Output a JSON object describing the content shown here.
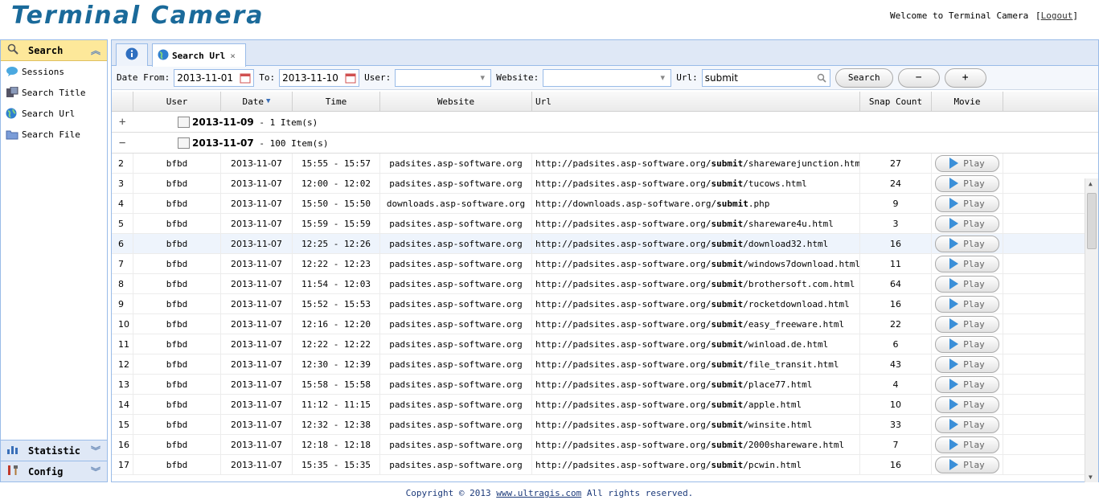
{
  "app": {
    "title": "Terminal Camera",
    "welcome": "Welcome to Terminal Camera",
    "logout": "Logout",
    "bracket_open": "[",
    "bracket_close": "]"
  },
  "sidebar": {
    "search_header": "Search",
    "items": [
      {
        "label": "Sessions",
        "icon": "sessions-icon"
      },
      {
        "label": "Search Title",
        "icon": "search-title-icon"
      },
      {
        "label": "Search Url",
        "icon": "globe-icon"
      },
      {
        "label": "Search File",
        "icon": "folder-icon"
      }
    ],
    "statistic_header": "Statistic",
    "config_header": "Config"
  },
  "tabs": {
    "info_icon": "info-icon",
    "active_label": "Search Url",
    "close": "×"
  },
  "toolbar": {
    "date_from_label": "Date From:",
    "date_from_value": "2013-11-01",
    "to_label": "To:",
    "to_value": "2013-11-10",
    "user_label": "User:",
    "user_value": "",
    "website_label": "Website:",
    "website_value": "",
    "url_label": "Url:",
    "url_value": "submit",
    "search_button": "Search",
    "collapse_button": "−",
    "expand_button": "+"
  },
  "grid": {
    "columns": [
      "",
      "User",
      "Date",
      "Time",
      "Website",
      "Url",
      "Snap Count",
      "Movie"
    ],
    "sort_indicator": "▼",
    "groups": [
      {
        "toggle": "+",
        "date": "2013-11-09",
        "summary": " - 1 Item(s)"
      },
      {
        "toggle": "−",
        "date": "2013-11-07",
        "summary": " - 100 Item(s)"
      }
    ],
    "play_label": "Play",
    "rows": [
      {
        "n": "2",
        "user": "bfbd",
        "date": "2013-11-07",
        "time": "15:55 - 15:57",
        "website": "padsites.asp-software.org",
        "url_pre": "http://padsites.asp-software.org/",
        "url_hl": "submit",
        "url_post": "/sharewarejunction.html",
        "snap": "27"
      },
      {
        "n": "3",
        "user": "bfbd",
        "date": "2013-11-07",
        "time": "12:00 - 12:02",
        "website": "padsites.asp-software.org",
        "url_pre": "http://padsites.asp-software.org/",
        "url_hl": "submit",
        "url_post": "/tucows.html",
        "snap": "24"
      },
      {
        "n": "4",
        "user": "bfbd",
        "date": "2013-11-07",
        "time": "15:50 - 15:50",
        "website": "downloads.asp-software.org",
        "url_pre": "http://downloads.asp-software.org/",
        "url_hl": "submit",
        "url_post": ".php",
        "snap": "9"
      },
      {
        "n": "5",
        "user": "bfbd",
        "date": "2013-11-07",
        "time": "15:59 - 15:59",
        "website": "padsites.asp-software.org",
        "url_pre": "http://padsites.asp-software.org/",
        "url_hl": "submit",
        "url_post": "/shareware4u.html",
        "snap": "3"
      },
      {
        "n": "6",
        "user": "bfbd",
        "date": "2013-11-07",
        "time": "12:25 - 12:26",
        "website": "padsites.asp-software.org",
        "url_pre": "http://padsites.asp-software.org/",
        "url_hl": "submit",
        "url_post": "/download32.html",
        "snap": "16"
      },
      {
        "n": "7",
        "user": "bfbd",
        "date": "2013-11-07",
        "time": "12:22 - 12:23",
        "website": "padsites.asp-software.org",
        "url_pre": "http://padsites.asp-software.org/",
        "url_hl": "submit",
        "url_post": "/windows7download.html",
        "snap": "11"
      },
      {
        "n": "8",
        "user": "bfbd",
        "date": "2013-11-07",
        "time": "11:54 - 12:03",
        "website": "padsites.asp-software.org",
        "url_pre": "http://padsites.asp-software.org/",
        "url_hl": "submit",
        "url_post": "/brothersoft.com.html",
        "snap": "64"
      },
      {
        "n": "9",
        "user": "bfbd",
        "date": "2013-11-07",
        "time": "15:52 - 15:53",
        "website": "padsites.asp-software.org",
        "url_pre": "http://padsites.asp-software.org/",
        "url_hl": "submit",
        "url_post": "/rocketdownload.html",
        "snap": "16"
      },
      {
        "n": "10",
        "user": "bfbd",
        "date": "2013-11-07",
        "time": "12:16 - 12:20",
        "website": "padsites.asp-software.org",
        "url_pre": "http://padsites.asp-software.org/",
        "url_hl": "submit",
        "url_post": "/easy_freeware.html",
        "snap": "22"
      },
      {
        "n": "11",
        "user": "bfbd",
        "date": "2013-11-07",
        "time": "12:22 - 12:22",
        "website": "padsites.asp-software.org",
        "url_pre": "http://padsites.asp-software.org/",
        "url_hl": "submit",
        "url_post": "/winload.de.html",
        "snap": "6"
      },
      {
        "n": "12",
        "user": "bfbd",
        "date": "2013-11-07",
        "time": "12:30 - 12:39",
        "website": "padsites.asp-software.org",
        "url_pre": "http://padsites.asp-software.org/",
        "url_hl": "submit",
        "url_post": "/file_transit.html",
        "snap": "43"
      },
      {
        "n": "13",
        "user": "bfbd",
        "date": "2013-11-07",
        "time": "15:58 - 15:58",
        "website": "padsites.asp-software.org",
        "url_pre": "http://padsites.asp-software.org/",
        "url_hl": "submit",
        "url_post": "/place77.html",
        "snap": "4"
      },
      {
        "n": "14",
        "user": "bfbd",
        "date": "2013-11-07",
        "time": "11:12 - 11:15",
        "website": "padsites.asp-software.org",
        "url_pre": "http://padsites.asp-software.org/",
        "url_hl": "submit",
        "url_post": "/apple.html",
        "snap": "10"
      },
      {
        "n": "15",
        "user": "bfbd",
        "date": "2013-11-07",
        "time": "12:32 - 12:38",
        "website": "padsites.asp-software.org",
        "url_pre": "http://padsites.asp-software.org/",
        "url_hl": "submit",
        "url_post": "/winsite.html",
        "snap": "33"
      },
      {
        "n": "16",
        "user": "bfbd",
        "date": "2013-11-07",
        "time": "12:18 - 12:18",
        "website": "padsites.asp-software.org",
        "url_pre": "http://padsites.asp-software.org/",
        "url_hl": "submit",
        "url_post": "/2000shareware.html",
        "snap": "7"
      },
      {
        "n": "17",
        "user": "bfbd",
        "date": "2013-11-07",
        "time": "15:35 - 15:35",
        "website": "padsites.asp-software.org",
        "url_pre": "http://padsites.asp-software.org/",
        "url_hl": "submit",
        "url_post": "/pcwin.html",
        "snap": "16"
      }
    ]
  },
  "footer": {
    "copyright": "Copyright © 2013 ",
    "link": "www.ultragis.com",
    "rights": " All rights reserved."
  },
  "colors": {
    "brand": "#1a6a9a",
    "panel_border": "#99bbe8",
    "active_accordion": "#fde89a",
    "play_icon": "#3b8fd8"
  }
}
